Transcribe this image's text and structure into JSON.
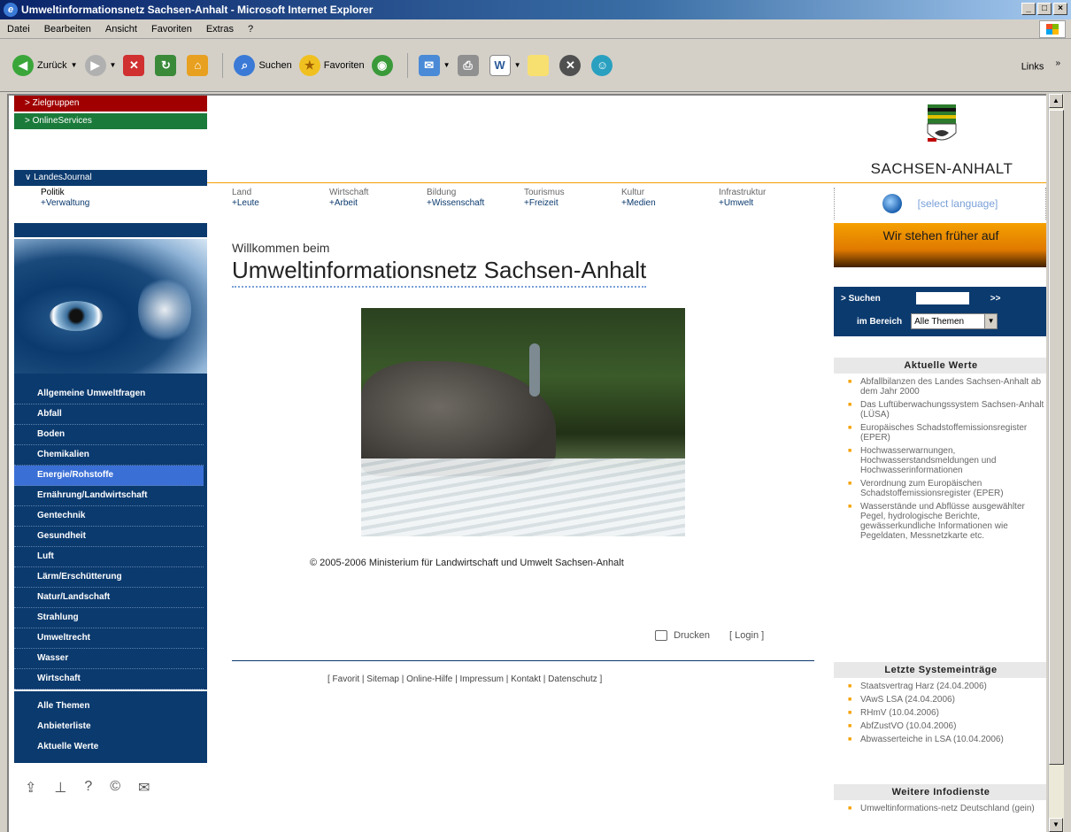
{
  "window": {
    "title": "Umweltinformationsnetz Sachsen-Anhalt - Microsoft Internet Explorer",
    "controls": [
      "_",
      "□",
      "×"
    ]
  },
  "menu": [
    "Datei",
    "Bearbeiten",
    "Ansicht",
    "Favoriten",
    "Extras",
    "?"
  ],
  "toolbar": {
    "back": "Zurück",
    "search": "Suchen",
    "favorites": "Favoriten",
    "links": "Links",
    "links_chevron": "»"
  },
  "left": {
    "zielgruppen": "> Zielgruppen",
    "onlineservices": "> OnlineServices",
    "landesjournal": "∨ LandesJournal",
    "lj_line1": "Politik",
    "lj_line2": "+Verwaltung",
    "nav": [
      "Allgemeine Umweltfragen",
      "Abfall",
      "Boden",
      "Chemikalien",
      "Energie/Rohstoffe",
      "Ernährung/Landwirtschaft",
      "Gentechnik",
      "Gesundheit",
      "Luft",
      "Lärm/Erschütterung",
      "Natur/Landschaft",
      "Strahlung",
      "Umweltrecht",
      "Wasser",
      "Wirtschaft"
    ],
    "nav2": [
      "Alle Themen",
      "Anbieterliste",
      "Aktuelle Werte"
    ],
    "utility_icons": [
      "share-icon",
      "sitemap-icon",
      "help-icon",
      "copyright-icon",
      "mail-icon"
    ]
  },
  "header": {
    "state_name": "SACHSEN-ANHALT",
    "categories": [
      {
        "top": "Land",
        "sub": "+Leute"
      },
      {
        "top": "Wirtschaft",
        "sub": "+Arbeit"
      },
      {
        "top": "Bildung",
        "sub": "+Wissenschaft"
      },
      {
        "top": "Tourismus",
        "sub": "+Freizeit"
      },
      {
        "top": "Kultur",
        "sub": "+Medien"
      },
      {
        "top": "Infrastruktur",
        "sub": "+Umwelt"
      }
    ],
    "language": "[select language]"
  },
  "main": {
    "welcome_small": "Willkommen beim",
    "welcome_big": "Umweltinformationsnetz Sachsen-Anhalt",
    "copyright": "© 2005-2006 Ministerium für Landwirtschaft und Umwelt Sachsen-Anhalt",
    "print": "Drucken",
    "login": "[ Login ]",
    "footer": "[ Favorit | Sitemap | Online-Hilfe | Impressum | Kontakt | Datenschutz ]"
  },
  "right": {
    "banner": "Wir stehen früher auf",
    "search_label": "> Suchen",
    "search_go": ">>",
    "area_label": "im Bereich",
    "area_value": "Alle Themen",
    "box1": {
      "title": "Aktuelle Werte",
      "items": [
        "Abfallbilanzen des Landes Sachsen-Anhalt ab dem Jahr 2000",
        "Das Luftüberwachungssystem Sachsen-Anhalt (LÜSA)",
        "Europäisches Schadstoffemissionsregister (EPER)",
        "Hochwasserwarnungen, Hochwasserstandsmeldungen und Hochwasserinformationen",
        "Verordnung zum Europäischen Schadstoffemissionsregister (EPER)",
        "Wasserstände und Abflüsse ausgewählter Pegel, hydrologische Berichte, gewässerkundliche Informationen wie Pegeldaten, Messnetzkarte etc."
      ]
    },
    "box2": {
      "title": "Letzte Systemeinträge",
      "items": [
        "Staatsvertrag Harz (24.04.2006)",
        "VAwS LSA (24.04.2006)",
        "RHmV (10.04.2006)",
        "AbfZustVO (10.04.2006)",
        "Abwasserteiche in LSA (10.04.2006)"
      ]
    },
    "box3": {
      "title": "Weitere Infodienste",
      "items": [
        "Umweltinformations-netz Deutschland (gein)"
      ]
    }
  }
}
